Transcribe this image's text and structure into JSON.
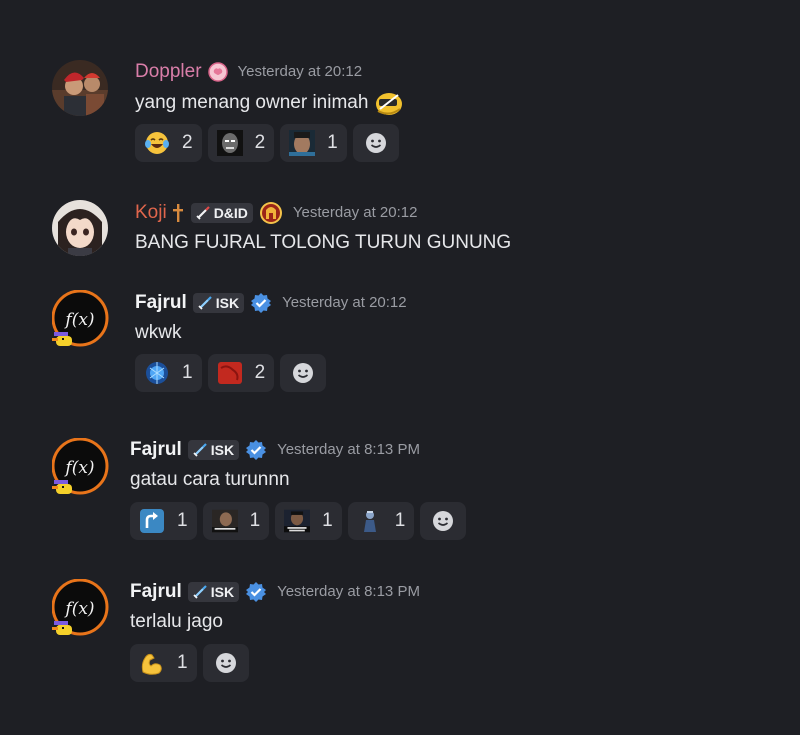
{
  "messages": [
    {
      "username": "Doppler",
      "username_color": "#d97ea9",
      "timestamp": "Yesterday at 20:12",
      "content": "yang menang owner inimah",
      "reactions": [
        {
          "icon": "laughing-crying-emoji",
          "count": "2"
        },
        {
          "icon": "custom-face-emoji",
          "count": "2"
        },
        {
          "icon": "custom-photo-emoji",
          "count": "1"
        }
      ]
    },
    {
      "username": "Koji",
      "username_color": "#e0664c",
      "tag": "D&ID",
      "timestamp": "Yesterday at 20:12",
      "content": "BANG FUJRAL TOLONG TURUN GUNUNG"
    },
    {
      "username": "Fajrul",
      "username_color": "#f2f3f5",
      "tag": "ISK",
      "timestamp": "Yesterday at 20:12",
      "content": "wkwk",
      "reactions": [
        {
          "icon": "blue-brain-emoji",
          "count": "1"
        },
        {
          "icon": "red-blob-emoji",
          "count": "2"
        }
      ]
    },
    {
      "username": "Fajrul",
      "username_color": "#f2f3f5",
      "tag": "ISK",
      "timestamp": "Yesterday at 8:13 PM",
      "content": "gatau cara turunnn",
      "reactions": [
        {
          "icon": "arrow-up-right-emoji",
          "count": "1"
        },
        {
          "icon": "custom-meme-emoji-1",
          "count": "1"
        },
        {
          "icon": "custom-meme-emoji-2",
          "count": "1"
        },
        {
          "icon": "custom-figure-emoji",
          "count": "1"
        }
      ]
    },
    {
      "username": "Fajrul",
      "username_color": "#f2f3f5",
      "tag": "ISK",
      "timestamp": "Yesterday at 8:13 PM",
      "content": "terlalu jago",
      "reactions": [
        {
          "icon": "flexed-biceps-emoji",
          "count": "1"
        }
      ]
    }
  ],
  "colors": {
    "background": "#1e1f24",
    "reaction_bg": "#2b2c32",
    "timestamp": "#9a9ca3",
    "verified": "#4a90e2"
  }
}
